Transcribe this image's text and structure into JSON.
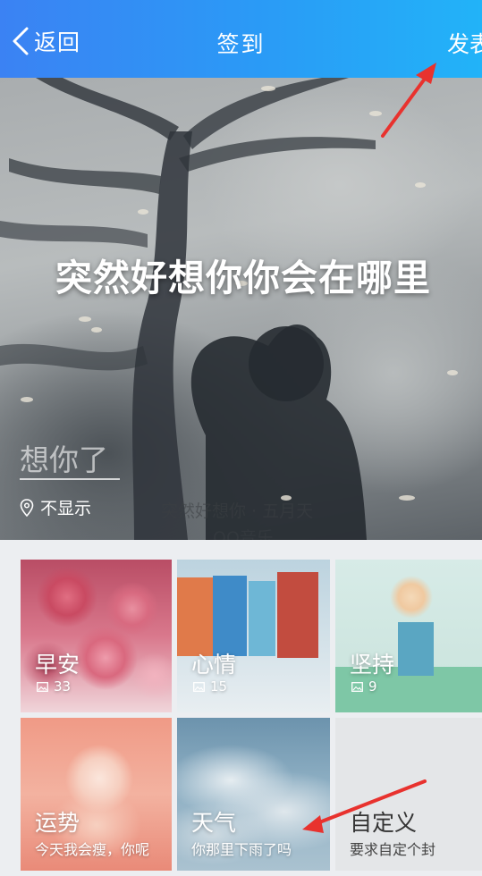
{
  "navbar": {
    "back_label": "返回",
    "title": "签到",
    "publish_label": "发表",
    "gradient_start": "#3b82f3",
    "gradient_end": "#22b3f8"
  },
  "hero": {
    "quote": "突然好想你你会在哪里",
    "input_placeholder": "想你了",
    "location_label": "不显示",
    "music_line": "突然好想你 · 五月天",
    "music_brand": "QQ音乐"
  },
  "tiles": [
    {
      "title": "早安",
      "count": "33"
    },
    {
      "title": "心情",
      "count": "15"
    },
    {
      "title": "坚持",
      "count": "9"
    },
    {
      "title": "运势",
      "subtitle": "今天我会瘦，你呢"
    },
    {
      "title": "天气",
      "subtitle": "你那里下雨了吗"
    },
    {
      "title": "自定义",
      "subtitle": "要求自定个封"
    }
  ],
  "annotation_color": "#e8322e"
}
